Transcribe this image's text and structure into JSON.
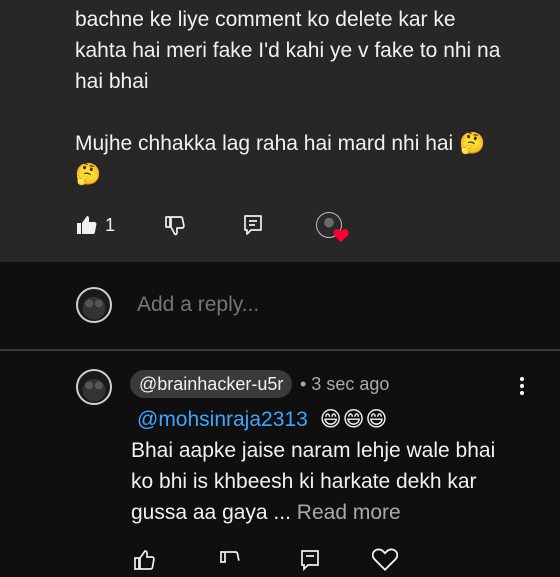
{
  "top_comment": {
    "lines": [
      "bachne ke liye comment ko delete kar ke",
      "kahta hai meri fake I'd kahi ye v fake to nhi na",
      "hai bhai",
      "Mujhe chhakka lag raha hai mard nhi hai 🤔",
      "🤔"
    ],
    "like_count": "1"
  },
  "reply_bar": {
    "placeholder": "Add a reply..."
  },
  "reply": {
    "handle": "@brainhacker-u5r",
    "time": "• 3 sec ago",
    "mention": "@mohsinraja2313",
    "emojis": "😄😄😄",
    "text_lines": [
      "Bhai aapke jaise naram lehje wale bhai",
      "ko bhi is khbeesh ki harkate dekh kar",
      "gussa aa gaya ..."
    ],
    "read_more": "Read more"
  },
  "icons": {
    "like": "thumbs-up-icon",
    "dislike": "thumbs-down-icon",
    "reply": "comment-icon",
    "creator_heart": "heart-icon",
    "more": "more-vert-icon"
  },
  "colors": {
    "comment_bg": "#272727",
    "page_bg": "#0f0f0f",
    "link_blue": "#3ea6ff",
    "heart_red": "#ff0033",
    "secondary_text": "#aaaaaa"
  }
}
